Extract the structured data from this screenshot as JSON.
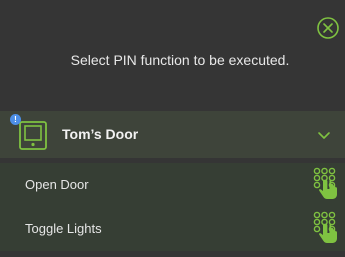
{
  "dialog": {
    "prompt": "Select PIN function to be executed.",
    "close_icon": "close-circle-icon"
  },
  "device": {
    "name": "Tom’s Door",
    "icon": "door-panel-icon",
    "badge": "!",
    "expand_icon": "chevron-down-icon"
  },
  "actions": [
    {
      "label": "Open Door",
      "icon": "pin-keypad-hand-icon"
    },
    {
      "label": "Toggle Lights",
      "icon": "pin-keypad-hand-icon"
    }
  ],
  "colors": {
    "background": "#353535",
    "accent_green": "#7fc241",
    "device_row_bg": "#3e443a",
    "action_row_bg": "#363e34",
    "badge_blue": "#4d8fe6"
  }
}
